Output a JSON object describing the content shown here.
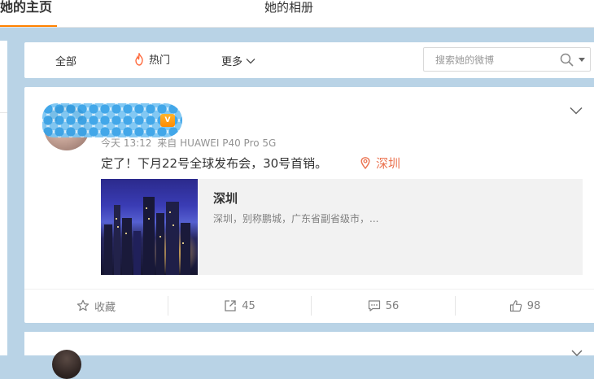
{
  "tabs": {
    "home": "她的主页",
    "album": "她的相册"
  },
  "filter": {
    "all": "全部",
    "hot": "热门",
    "more": "更多",
    "search_placeholder": "搜索她的微博"
  },
  "post": {
    "username": "",
    "time": "今天 13:12",
    "source_prefix": "来自",
    "source_device": "HUAWEI P40 Pro 5G",
    "text": "定了！下月22号全球发布会，30号首销。",
    "location": "深圳",
    "location_card": {
      "title": "深圳",
      "description": "深圳，别称鹏城，广东省副省级市，..."
    },
    "actions": {
      "favorite": "收藏",
      "repost": "45",
      "comment": "56",
      "like": "98"
    }
  },
  "colors": {
    "accent": "#ff8200",
    "location": "#eb7350",
    "page_background": "#b9d3e6"
  },
  "icons": [
    "fire-icon",
    "chevron-down-icon",
    "search-icon",
    "location-pin-icon",
    "star-icon",
    "repost-icon",
    "comment-icon",
    "like-icon"
  ]
}
